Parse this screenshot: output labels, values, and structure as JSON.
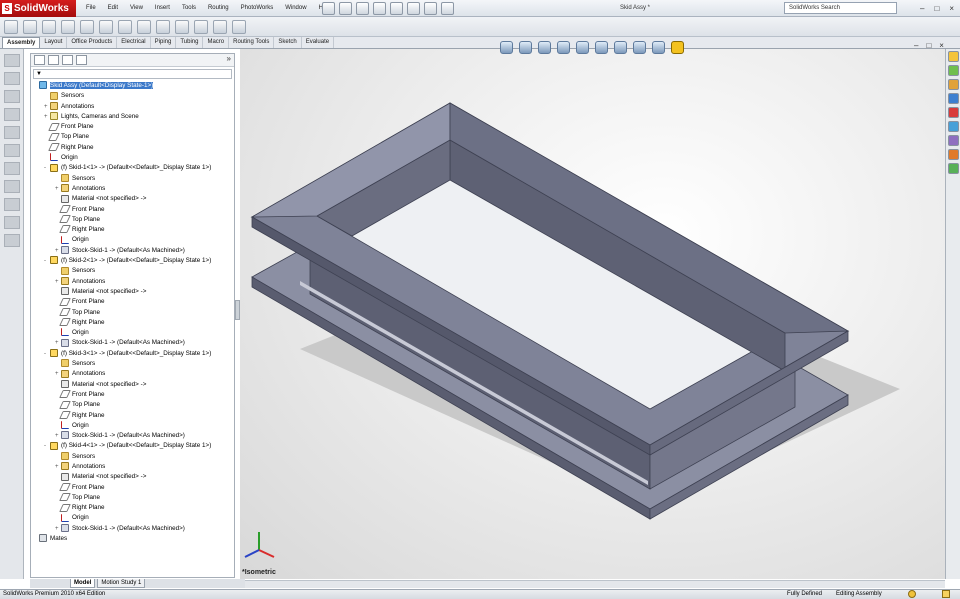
{
  "app": {
    "logo_text": "SolidWorks",
    "document_title": "Skid Assy *",
    "search_placeholder": "SolidWorks Search"
  },
  "menu": [
    "File",
    "Edit",
    "View",
    "Insert",
    "Tools",
    "Routing",
    "PhotoWorks",
    "Window",
    "Help"
  ],
  "command_tabs": [
    "Assembly",
    "Layout",
    "Office Products",
    "Electrical",
    "Piping",
    "Tubing",
    "Macro",
    "Routing Tools",
    "Sketch",
    "Evaluate"
  ],
  "active_command_tab": "Assembly",
  "tree": {
    "rows": [
      {
        "label": "Skid Assy  (Default<Display State-1>)",
        "icon": "assembly",
        "level": 0,
        "selected": true
      },
      {
        "label": "Sensors",
        "icon": "folder",
        "level": 1
      },
      {
        "label": "Annotations",
        "icon": "annotation",
        "level": 1,
        "expander": "+"
      },
      {
        "label": "Lights, Cameras and Scene",
        "icon": "lights",
        "level": 1,
        "expander": "+"
      },
      {
        "label": "Front Plane",
        "icon": "plane",
        "level": 1
      },
      {
        "label": "Top Plane",
        "icon": "plane",
        "level": 1
      },
      {
        "label": "Right Plane",
        "icon": "plane",
        "level": 1
      },
      {
        "label": "Origin",
        "icon": "origin",
        "level": 1
      },
      {
        "label": "(f) Skid-1<1> -> (Default<<Default>_Display State 1>)",
        "icon": "part",
        "level": 1,
        "expander": "-"
      },
      {
        "label": "Sensors",
        "icon": "folder",
        "level": 2
      },
      {
        "label": "Annotations",
        "icon": "annotation",
        "level": 2,
        "expander": "+"
      },
      {
        "label": "Material <not specified> ->",
        "icon": "material",
        "level": 2
      },
      {
        "label": "Front Plane",
        "icon": "plane",
        "level": 2
      },
      {
        "label": "Top Plane",
        "icon": "plane",
        "level": 2
      },
      {
        "label": "Right Plane",
        "icon": "plane",
        "level": 2
      },
      {
        "label": "Origin",
        "icon": "origin",
        "level": 2
      },
      {
        "label": "Stock-Skid-1 -> (Default<As Machined>)",
        "icon": "feature",
        "level": 2,
        "expander": "+"
      },
      {
        "label": "(f) Skid-2<1> -> (Default<<Default>_Display State 1>)",
        "icon": "part",
        "level": 1,
        "expander": "-"
      },
      {
        "label": "Sensors",
        "icon": "folder",
        "level": 2
      },
      {
        "label": "Annotations",
        "icon": "annotation",
        "level": 2,
        "expander": "+"
      },
      {
        "label": "Material <not specified> ->",
        "icon": "material",
        "level": 2
      },
      {
        "label": "Front Plane",
        "icon": "plane",
        "level": 2
      },
      {
        "label": "Top Plane",
        "icon": "plane",
        "level": 2
      },
      {
        "label": "Right Plane",
        "icon": "plane",
        "level": 2
      },
      {
        "label": "Origin",
        "icon": "origin",
        "level": 2
      },
      {
        "label": "Stock-Skid-1 -> (Default<As Machined>)",
        "icon": "feature",
        "level": 2,
        "expander": "+"
      },
      {
        "label": "(f) Skid-3<1> -> (Default<<Default>_Display State 1>)",
        "icon": "part",
        "level": 1,
        "expander": "-"
      },
      {
        "label": "Sensors",
        "icon": "folder",
        "level": 2
      },
      {
        "label": "Annotations",
        "icon": "annotation",
        "level": 2,
        "expander": "+"
      },
      {
        "label": "Material <not specified> ->",
        "icon": "material",
        "level": 2
      },
      {
        "label": "Front Plane",
        "icon": "plane",
        "level": 2
      },
      {
        "label": "Top Plane",
        "icon": "plane",
        "level": 2
      },
      {
        "label": "Right Plane",
        "icon": "plane",
        "level": 2
      },
      {
        "label": "Origin",
        "icon": "origin",
        "level": 2
      },
      {
        "label": "Stock-Skid-1 -> (Default<As Machined>)",
        "icon": "feature",
        "level": 2,
        "expander": "+"
      },
      {
        "label": "(f) Skid-4<1> -> (Default<<Default>_Display State 1>)",
        "icon": "part",
        "level": 1,
        "expander": "-"
      },
      {
        "label": "Sensors",
        "icon": "folder",
        "level": 2
      },
      {
        "label": "Annotations",
        "icon": "annotation",
        "level": 2,
        "expander": "+"
      },
      {
        "label": "Material <not specified> ->",
        "icon": "material",
        "level": 2
      },
      {
        "label": "Front Plane",
        "icon": "plane",
        "level": 2
      },
      {
        "label": "Top Plane",
        "icon": "plane",
        "level": 2
      },
      {
        "label": "Right Plane",
        "icon": "plane",
        "level": 2
      },
      {
        "label": "Origin",
        "icon": "origin",
        "level": 2
      },
      {
        "label": "Stock-Skid-1 -> (Default<As Machined>)",
        "icon": "feature",
        "level": 2,
        "expander": "+"
      },
      {
        "label": "Mates",
        "icon": "mates",
        "level": 0
      }
    ]
  },
  "viewport": {
    "view_name": "*Isometric",
    "model_color": "#6e7287"
  },
  "bottom_tabs": [
    "Model",
    "Motion Study 1"
  ],
  "active_bottom_tab": "Model",
  "status": {
    "app_edition": "SolidWorks Premium 2010 x64 Edition",
    "state": "Fully Defined",
    "mode": "Editing Assembly"
  },
  "icons": {
    "toolbar": [
      "new-icon",
      "open-icon",
      "save-icon",
      "print-icon",
      "undo-icon",
      "select-icon",
      "rebuild-icon",
      "options-icon"
    ],
    "hud": [
      "zoom-to-fit-icon",
      "zoom-area-icon",
      "previous-view-icon",
      "section-view-icon",
      "view-orientation-icon",
      "display-style-icon",
      "hide-show-icon",
      "edit-appearance-icon",
      "apply-scene-icon",
      "realview-icon"
    ],
    "task_pane": [
      "resources-icon",
      "design-library-icon",
      "file-explorer-icon",
      "search-results-icon",
      "view-palette-icon",
      "appearances-icon",
      "custom-properties-icon",
      "photoworks-icon",
      "solidworks-forum-icon"
    ]
  },
  "colors": {
    "accent": "#3a78c9",
    "logo_red": "#c4161c",
    "selected_row": "#3a78c9"
  }
}
